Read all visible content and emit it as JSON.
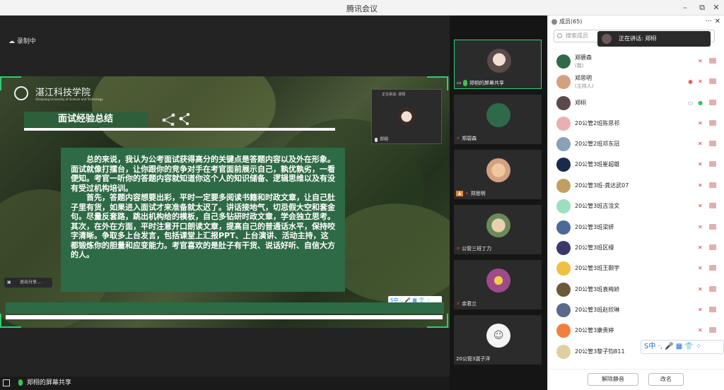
{
  "window": {
    "title": "腾讯会议",
    "minimize": "–",
    "maximize": "⧉",
    "close": "✕"
  },
  "recording": {
    "label": "录制中"
  },
  "slide": {
    "school": "湛江科技学院",
    "school_en": "Zhanjiang University of Science and Technology",
    "heading": "面试经验总结",
    "mini_bar": "正在讲话: 郑栩",
    "paragraphs": [
      "总的来说，我认为公考面试获得高分的关键点是答题内容以及外在形象。面试就像打擂台，让你跟你的竞争对手在考官面前展示自己，孰优孰劣，一看便知。考官一听你的答题内容就知道你这个人的知识储备、逻辑思维以及有没有受过机构培训。",
      "首先，答题内容想要出彩，平时一定要多阅读书籍和时政文章，让自己肚子里有货，如果进入面试才来准备就太迟了。讲话接地气，切忌假大空和套金句。尽量反套路，跳出机构给的模板，自己多钻研时政文章，学会独立思考。",
      "其次，在外在方面，平时注意开口朗读文章，提高自己的普通话水平，保持咬字清晰。争取多上台发言，包括课堂上汇报PPT、上台演讲、活动主持，这都锻炼你的胆量和应变能力。考官喜欢的是肚子有干货、说话好听、自信大方的人。"
    ],
    "ctrl_text": "退出分享...",
    "sogou_mini": "S中 ·, 🎤 ▦ 👕 ⁘"
  },
  "mini_video": {
    "name": "郑栩",
    "label": "正在讲话: 郑栩"
  },
  "status": {
    "share_label": "郑栩的屏幕共享"
  },
  "video_tiles": [
    {
      "name": "郑栩的屏幕共享",
      "color": "#5a4a4a"
    },
    {
      "name": "郑碧森",
      "color": "#2e6a4a"
    },
    {
      "name": "郑思明",
      "color": "#d4a080"
    },
    {
      "name": "公管三班丁力",
      "color": "#6a8a5a"
    },
    {
      "name": "余君兰",
      "color": "#a04a8a"
    },
    {
      "name": "20公管3渥子洋",
      "color": "#f4f4f4"
    }
  ],
  "members": {
    "header": "成员(65)",
    "more": "···",
    "close": "✕",
    "search_placeholder": "搜索成员",
    "speaking": "正在讲话: 郑栩",
    "rows": [
      {
        "name": "郑碧森",
        "sub": "(我)",
        "color": "#2e6a4a"
      },
      {
        "name": "郑思明",
        "sub": "(主持人)",
        "color": "#d4a080"
      },
      {
        "name": "郑栩",
        "sub": "",
        "color": "#5a4a4a"
      },
      {
        "name": "20公管2班陈思祁",
        "sub": "",
        "color": "#e8b0b0"
      },
      {
        "name": "20公管2班邓东冠",
        "sub": "",
        "color": "#8aa0b8"
      },
      {
        "name": "20公管3班崔超雄",
        "sub": "",
        "color": "#1a2a4a"
      },
      {
        "name": "20公管3班-龚达武07",
        "sub": "",
        "color": "#c0a060"
      },
      {
        "name": "20公管3班古淦文",
        "sub": "",
        "color": "#9adfc0"
      },
      {
        "name": "20公管3班梁妍",
        "sub": "",
        "color": "#4a6a9a"
      },
      {
        "name": "20公管3班区缦",
        "sub": "",
        "color": "#3a3a6a"
      },
      {
        "name": "20公管3班王颢宇",
        "sub": "",
        "color": "#f0c040"
      },
      {
        "name": "20公管3班袁梅娇",
        "sub": "",
        "color": "#6a5a3a"
      },
      {
        "name": "20公管3班赵欣琳",
        "sub": "",
        "color": "#5a6a8a"
      },
      {
        "name": "20公管3康贵婷",
        "sub": "",
        "color": "#f08040"
      },
      {
        "name": "20公管3黎子钧811",
        "sub": "",
        "color": "#e0d0a0"
      }
    ],
    "unmute_all": "解除静音",
    "rename": "改名"
  },
  "sogou": "S中 ·, 🎤 ▦ 👕 ⁘"
}
